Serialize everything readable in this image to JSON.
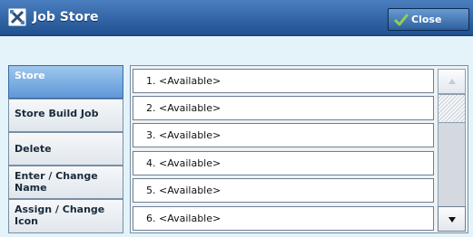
{
  "window": {
    "title": "Job Store",
    "title_icon": "job-store-icon",
    "close_label": "Close",
    "close_icon": "checkmark-icon"
  },
  "sidebar": {
    "items": [
      {
        "label": "Store",
        "selected": true
      },
      {
        "label": "Store Build Job",
        "selected": false
      },
      {
        "label": "Delete",
        "selected": false
      },
      {
        "label": "Enter / Change Name",
        "selected": false
      },
      {
        "label": "Assign / Change Icon",
        "selected": false
      }
    ]
  },
  "list": {
    "rows": [
      {
        "label": "1.  <Available>"
      },
      {
        "label": "2.  <Available>"
      },
      {
        "label": "3.  <Available>"
      },
      {
        "label": "4.  <Available>"
      },
      {
        "label": "5.  <Available>"
      },
      {
        "label": "6.  <Available>"
      }
    ]
  },
  "scrollbar": {
    "up_icon": "scroll-up-arrow-icon",
    "down_icon": "scroll-down-arrow-icon",
    "up_enabled": false,
    "down_enabled": true
  },
  "colors": {
    "titlebar": "#2f5f9f",
    "selected_item": "#5e98d8",
    "background": "#e4f3fa",
    "checkmark": "#8fd14f"
  }
}
